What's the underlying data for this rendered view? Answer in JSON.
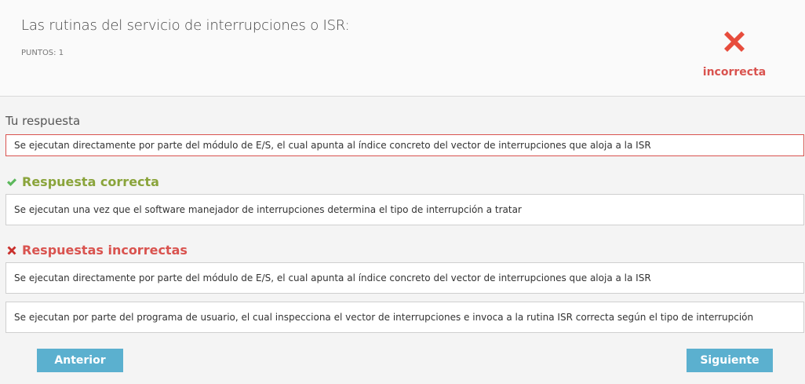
{
  "question": {
    "text": "Las rutinas del servicio de interrupciones o ISR:",
    "points": "PUNTOS: 1"
  },
  "result": {
    "icon": "cross-icon",
    "label": "incorrecta",
    "color": "#d9534f"
  },
  "your_answer": {
    "label": "Tu respuesta",
    "text": "Se ejecutan directamente por parte del módulo de E/S, el cual apunta al índice concreto del vector de interrupciones que aloja a la ISR"
  },
  "correct": {
    "heading": "Respuesta correcta",
    "icon": "check-icon",
    "color": "#8aa43b",
    "text": "Se ejecutan una vez que el software manejador de interrupciones determina el tipo de interrupción a tratar"
  },
  "incorrect": {
    "heading": "Respuestas incorrectas",
    "icon": "cross-icon",
    "items": [
      "Se ejecutan directamente por parte del módulo de E/S, el cual apunta al índice concreto del vector de interrupciones que aloja a la ISR",
      "Se ejecutan por parte del programa de usuario, el cual inspecciona el vector de interrupciones e invoca a la rutina ISR correcta según el tipo de interrupción"
    ]
  },
  "nav": {
    "prev_label": "Anterior",
    "next_label": "Siguiente",
    "button_color": "#5bb0cf"
  }
}
